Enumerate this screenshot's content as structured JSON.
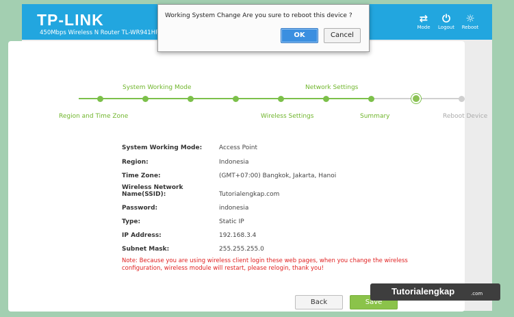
{
  "header": {
    "brand": "TP-LINK",
    "model": "450Mbps Wireless N Router TL-WR941HP",
    "buttons": {
      "mode": "Mode",
      "logout": "Logout",
      "reboot": "Reboot"
    },
    "icons": {
      "mode": "mode-icon",
      "logout": "power-icon",
      "reboot": "sun-icon"
    }
  },
  "wizard": {
    "steps_top": [
      "System Working Mode",
      "Network Settings"
    ],
    "steps_bottom": [
      "Region and Time Zone",
      "Wireless Settings",
      "Summary",
      "Reboot Device"
    ],
    "total_steps": 9,
    "current_step": 7
  },
  "summary": {
    "rows": [
      {
        "label": "System Working Mode:",
        "value": "Access Point"
      },
      {
        "label": "Region:",
        "value": "Indonesia"
      },
      {
        "label": "Time Zone:",
        "value": "(GMT+07:00) Bangkok, Jakarta, Hanoi"
      },
      {
        "label": "Wireless Network Name(SSID):",
        "value": "Tutorialengkap.com"
      },
      {
        "label": "Password:",
        "value": "indonesia"
      },
      {
        "label": "Type:",
        "value": "Static IP"
      },
      {
        "label": "IP Address:",
        "value": "192.168.3.4"
      },
      {
        "label": "Subnet Mask:",
        "value": "255.255.255.0"
      }
    ],
    "note": "Note: Because you are using wireless client login these web pages, when you change the wireless configuration, wireless module will restart, please relogin, thank you!"
  },
  "actions": {
    "back": "Back",
    "save": "Save"
  },
  "dialog": {
    "message": "Working System Change Are you sure to reboot this device ?",
    "ok": "OK",
    "cancel": "Cancel"
  },
  "watermark": {
    "main": "Tutorialengkap",
    "suffix": ".com"
  },
  "colors": {
    "header": "#22a6df",
    "accent_green": "#7cc04a",
    "note_red": "#e02020",
    "dialog_ok": "#3b8fe0"
  }
}
